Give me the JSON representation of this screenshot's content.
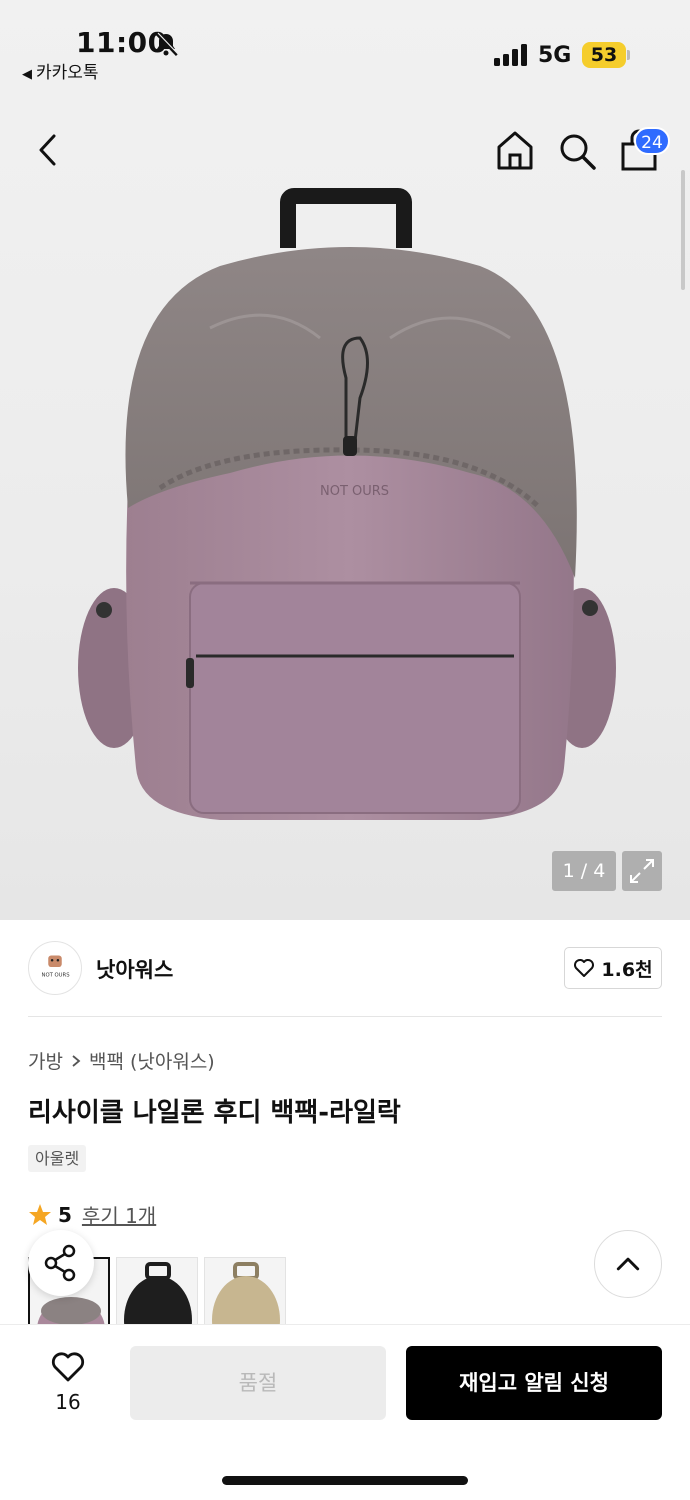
{
  "status_bar": {
    "time": "11:00",
    "back_app": "카카오톡",
    "network": "5G",
    "battery": "53"
  },
  "nav": {
    "cart_count": "24"
  },
  "gallery": {
    "counter": "1 / 4",
    "print_text": "NOT OURS"
  },
  "brand": {
    "name": "낫아워스",
    "logo_text": "NOT OURS",
    "likes": "1.6천"
  },
  "breadcrumb": {
    "category": "가방",
    "subcategory": "백팩 (낫아워스)"
  },
  "product": {
    "title": "리사이클 나일론 후디 백팩-라일락",
    "tag": "아울렛",
    "rating": "5",
    "review_link": "후기 1개"
  },
  "thumbnails": [
    {
      "color_hex": "#a9889b"
    },
    {
      "color_hex": "#1e1e1e"
    },
    {
      "color_hex": "#c7b690"
    }
  ],
  "bottom": {
    "wish_count": "16",
    "soldout_label": "품절",
    "restock_label": "재입고 알림 신청"
  },
  "colors": {
    "accent": "#2f6bff",
    "star": "#f5a623",
    "battery": "#f5cd2c"
  }
}
